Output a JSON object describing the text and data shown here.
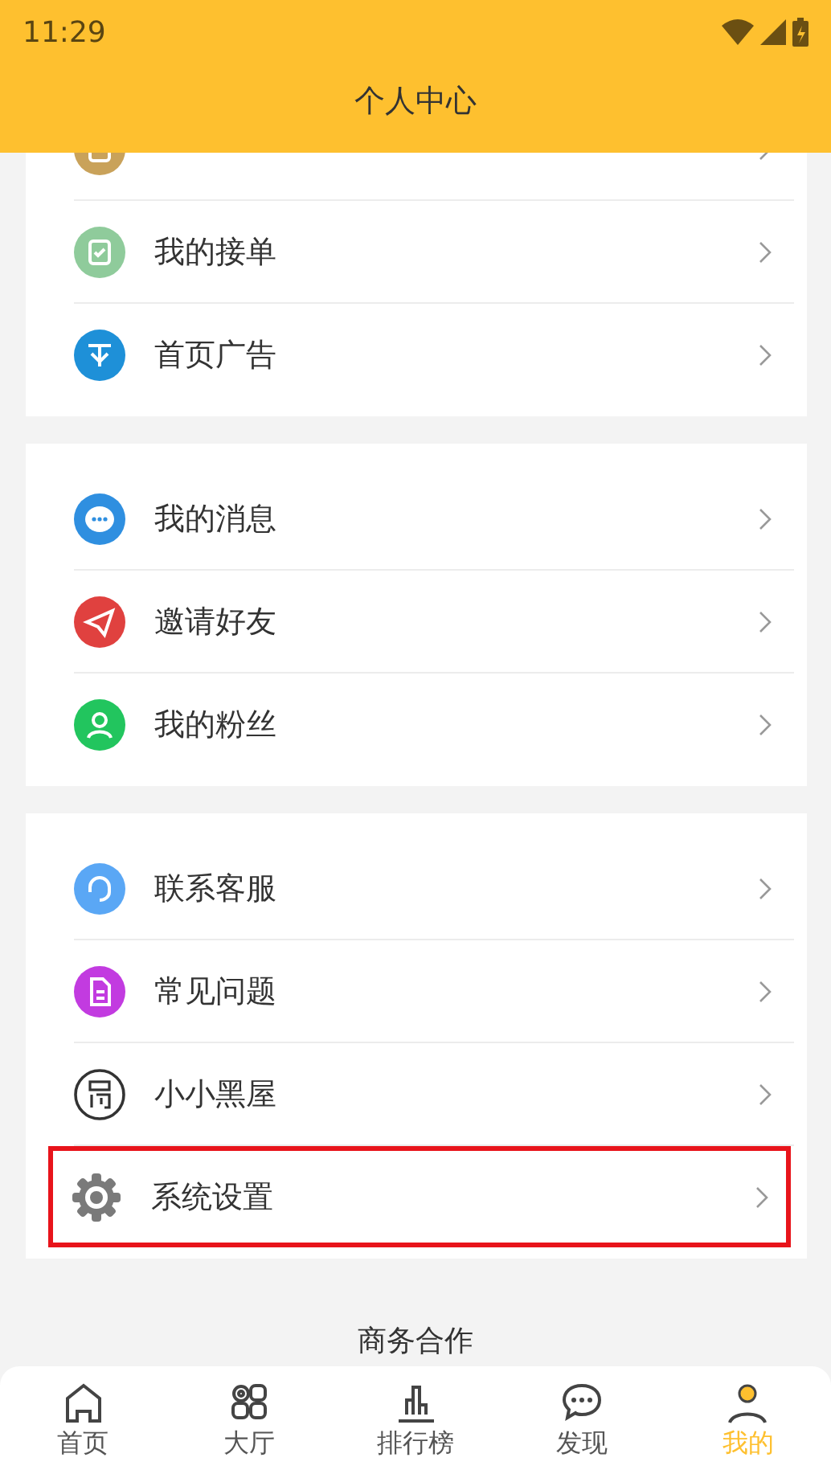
{
  "status_bar": {
    "time": "11:29"
  },
  "header": {
    "title": "个人中心"
  },
  "groups": [
    {
      "items": [
        {
          "color": "#c9a25a",
          "highlighted": false
        },
        {
          "label": "我的接单",
          "color": "#8fcb9b",
          "highlighted": false
        },
        {
          "label": "首页广告",
          "color": "#1e90d8",
          "highlighted": false
        }
      ]
    },
    {
      "items": [
        {
          "label": "我的消息",
          "color": "#2f8fe0",
          "highlighted": false
        },
        {
          "label": "邀请好友",
          "color": "#e0413f",
          "highlighted": false
        },
        {
          "label": "我的粉丝",
          "color": "#22c55e",
          "highlighted": false
        }
      ]
    },
    {
      "items": [
        {
          "label": "联系客服",
          "color": "#5aa7f5",
          "highlighted": false
        },
        {
          "label": "常见问题",
          "color": "#c23be0",
          "highlighted": false
        },
        {
          "label": "小小黑屋",
          "color": "#333333",
          "highlighted": false
        },
        {
          "label": "系统设置",
          "color": "#7a7a7a",
          "highlighted": true
        }
      ]
    }
  ],
  "footer_link": "商务合作",
  "tab_bar": [
    {
      "label": "首页",
      "selected": false
    },
    {
      "label": "大厅",
      "selected": false
    },
    {
      "label": "排行榜",
      "selected": false
    },
    {
      "label": "发现",
      "selected": false
    },
    {
      "label": "我的",
      "selected": true
    }
  ]
}
